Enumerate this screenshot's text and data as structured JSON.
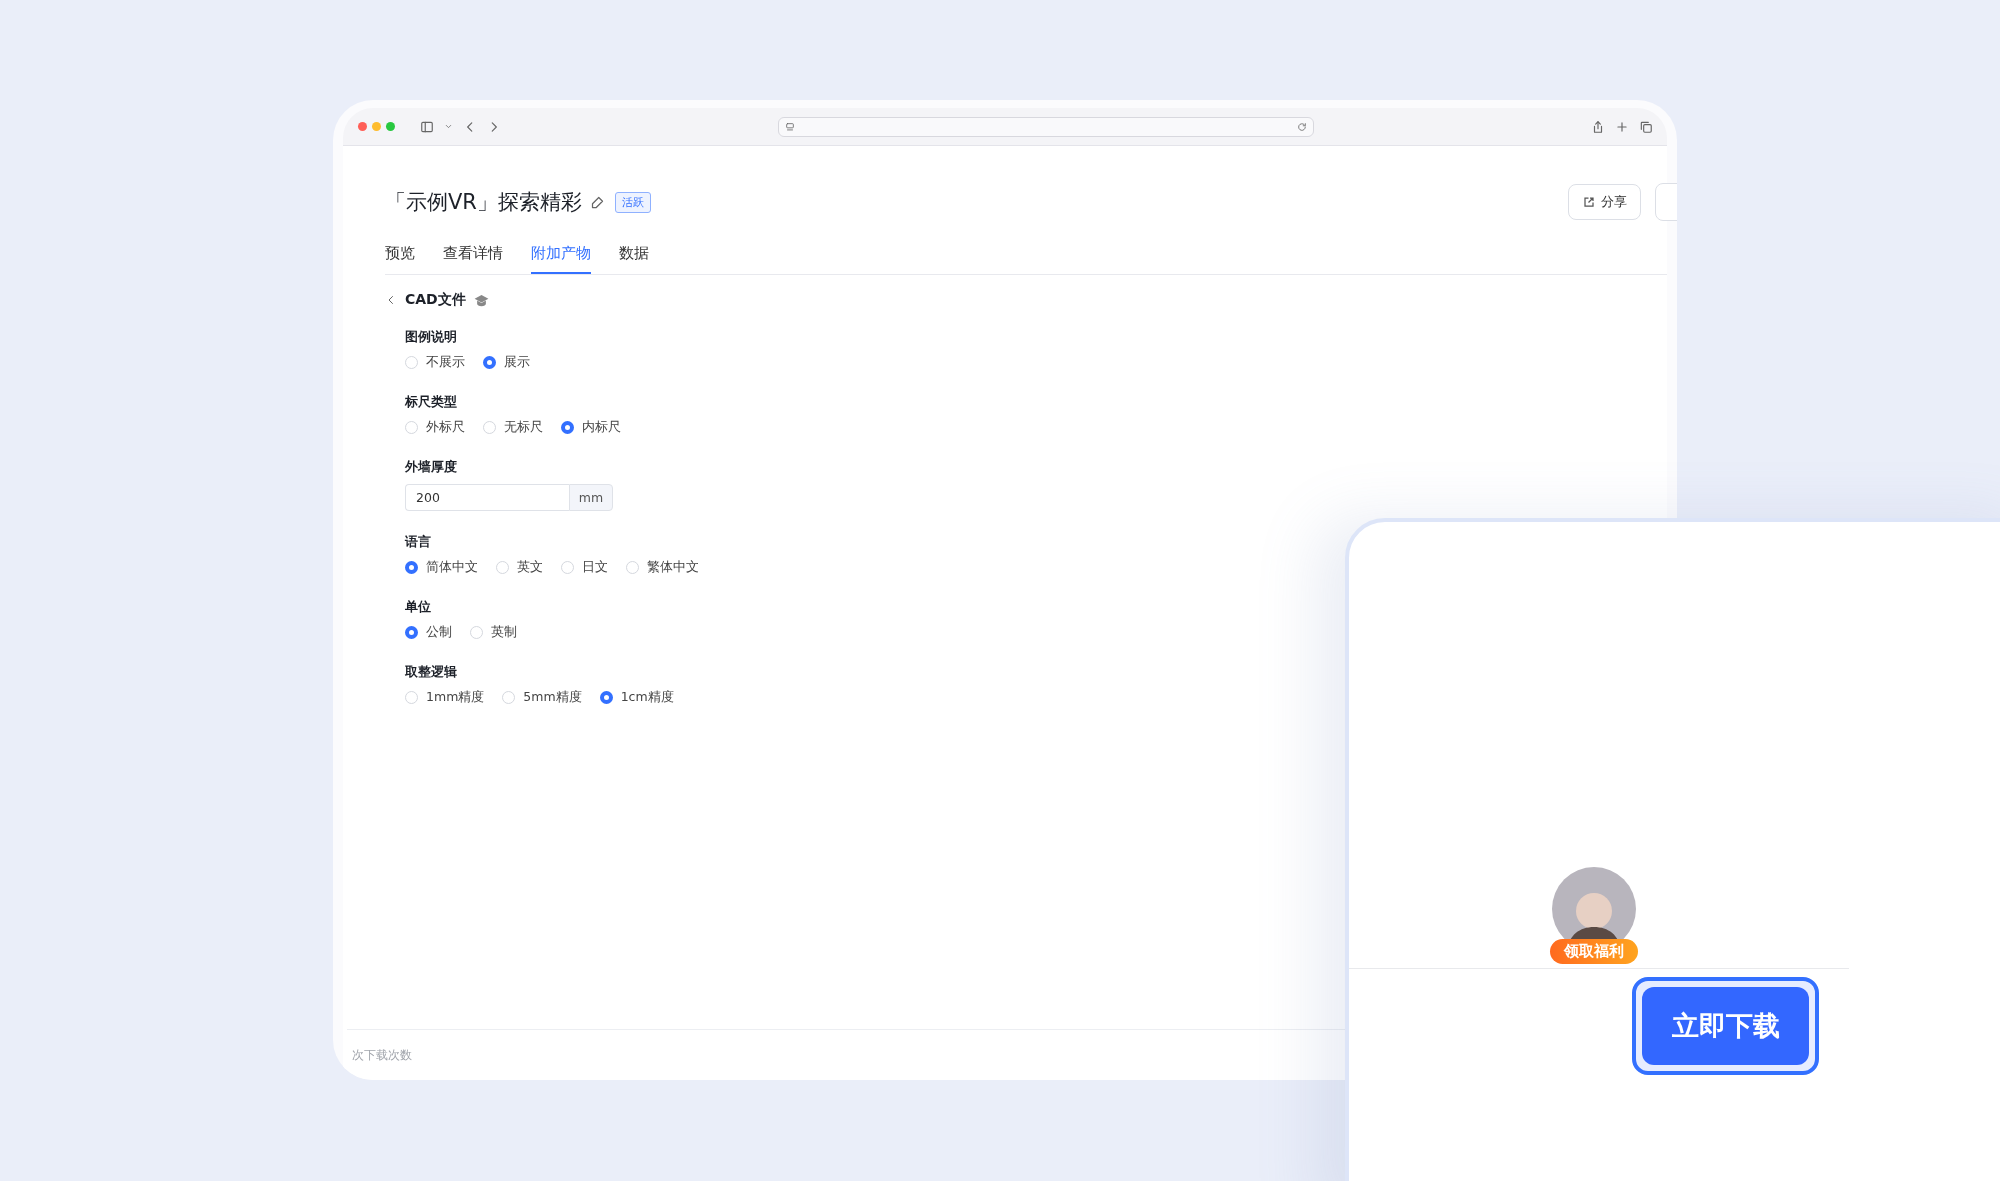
{
  "window": {
    "title": "「示例VR」探索精彩",
    "status_badge": "活跃",
    "share_button": "分享"
  },
  "tabs": [
    {
      "label": "预览",
      "selected": false
    },
    {
      "label": "查看详情",
      "selected": false
    },
    {
      "label": "附加产物",
      "selected": true
    },
    {
      "label": "数据",
      "selected": false
    }
  ],
  "section": {
    "title": "CAD文件"
  },
  "fields": [
    {
      "kind": "radio",
      "label": "图例说明",
      "options": [
        {
          "label": "不展示",
          "selected": false
        },
        {
          "label": "展示",
          "selected": true
        }
      ]
    },
    {
      "kind": "radio",
      "label": "标尺类型",
      "options": [
        {
          "label": "外标尺",
          "selected": false
        },
        {
          "label": "无标尺",
          "selected": false
        },
        {
          "label": "内标尺",
          "selected": true
        }
      ]
    },
    {
      "kind": "input",
      "label": "外墙厚度",
      "value": "200",
      "unit": "mm"
    },
    {
      "kind": "radio",
      "label": "语言",
      "options": [
        {
          "label": "简体中文",
          "selected": true
        },
        {
          "label": "英文",
          "selected": false
        },
        {
          "label": "日文",
          "selected": false
        },
        {
          "label": "繁体中文",
          "selected": false
        }
      ]
    },
    {
      "kind": "radio",
      "label": "单位",
      "options": [
        {
          "label": "公制",
          "selected": true
        },
        {
          "label": "英制",
          "selected": false
        }
      ]
    },
    {
      "kind": "radio",
      "label": "取整逻辑",
      "options": [
        {
          "label": "1mm精度",
          "selected": false
        },
        {
          "label": "5mm精度",
          "selected": false
        },
        {
          "label": "1cm精度",
          "selected": true
        }
      ]
    }
  ],
  "footer": {
    "text": "次下载次数"
  },
  "promo": {
    "badge": "领取福利",
    "button": "立即下载"
  }
}
